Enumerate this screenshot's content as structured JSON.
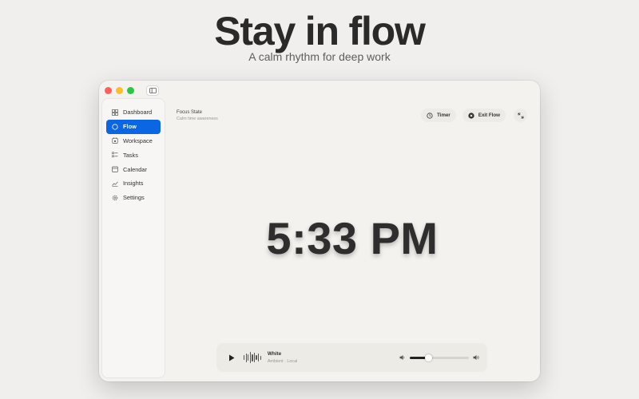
{
  "hero": {
    "title": "Stay in flow",
    "subtitle": "A calm rhythm for deep work"
  },
  "sidebar": {
    "items": [
      {
        "label": "Dashboard",
        "icon": "grid-icon"
      },
      {
        "label": "Flow",
        "icon": "circle-icon",
        "active": true
      },
      {
        "label": "Workspace",
        "icon": "workspace-icon"
      },
      {
        "label": "Tasks",
        "icon": "checklist-icon"
      },
      {
        "label": "Calendar",
        "icon": "calendar-icon"
      },
      {
        "label": "Insights",
        "icon": "chart-icon"
      },
      {
        "label": "Settings",
        "icon": "gear-icon"
      }
    ]
  },
  "header": {
    "title": "Focus State",
    "subtitle": "Calm time awareness"
  },
  "actions": {
    "timer_label": "Timer",
    "exit_label": "Exit Flow"
  },
  "clock": {
    "time": "5:33 PM"
  },
  "player": {
    "track_title": "White",
    "track_subtitle": "Ambient · Local",
    "volume": 0.32
  },
  "colors": {
    "accent": "#0a66e3",
    "background": "#f0efed"
  }
}
